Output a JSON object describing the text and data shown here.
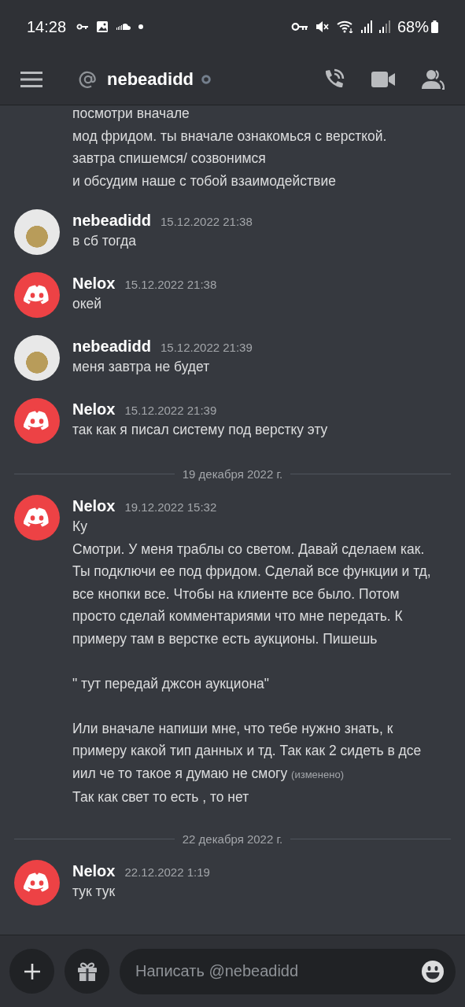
{
  "status_bar": {
    "time": "14:28",
    "battery": "68%"
  },
  "header": {
    "channel_name": "nebeadidd"
  },
  "feed": [
    {
      "kind": "continuation",
      "lines": [
        "посмотри вначале",
        "мод фридом. ты вначале ознакомься с версткой.",
        "завтра спишемся/ созвонимся",
        "и обсудим наше с тобой взаимодействие"
      ]
    },
    {
      "kind": "message",
      "author": "nebeadidd",
      "avatar": {
        "kind": "photo"
      },
      "time": "15.12.2022 21:38",
      "lines": [
        {
          "text": "в сб тогда"
        }
      ]
    },
    {
      "kind": "message",
      "author": "Nelox",
      "avatar": {
        "kind": "discord"
      },
      "time": "15.12.2022 21:38",
      "lines": [
        {
          "text": "окей"
        }
      ]
    },
    {
      "kind": "message",
      "author": "nebeadidd",
      "avatar": {
        "kind": "photo"
      },
      "time": "15.12.2022 21:39",
      "lines": [
        {
          "text": "меня завтра не будет"
        }
      ]
    },
    {
      "kind": "message",
      "author": "Nelox",
      "avatar": {
        "kind": "discord"
      },
      "time": "15.12.2022 21:39",
      "lines": [
        {
          "text": "так как я писал систему под верстку эту"
        }
      ]
    },
    {
      "kind": "divider",
      "label": "19 декабря 2022 г."
    },
    {
      "kind": "message",
      "author": "Nelox",
      "avatar": {
        "kind": "discord"
      },
      "time": "19.12.2022 15:32",
      "lines": [
        {
          "text": "Ку"
        },
        {
          "text": "Смотри. У меня траблы со светом. Давай сделаем как. Ты подключи ее под фридом. Сделай все функции и тд, все кнопки все. Чтобы на клиенте все было. Потом просто сделай комментариями что мне передать. К примеру там в верстке есть аукционы. Пишешь\n\n\" тут передай джсон аукциона\"\n\nИли вначале напиши мне, что тебе нужно знать, к примеру какой тип данных и тд. Так как 2 сидеть в дсе иил че то такое я думаю не смогу",
          "edited_label": "(изменено)"
        },
        {
          "text": "Так как свет то есть , то нет"
        }
      ]
    },
    {
      "kind": "divider",
      "label": "22 декабря 2022 г."
    },
    {
      "kind": "message",
      "author": "Nelox",
      "avatar": {
        "kind": "discord"
      },
      "time": "22.12.2022 1:19",
      "lines": [
        {
          "text": "тук тук"
        }
      ]
    }
  ],
  "composer": {
    "placeholder": "Написать @nebeadidd"
  }
}
